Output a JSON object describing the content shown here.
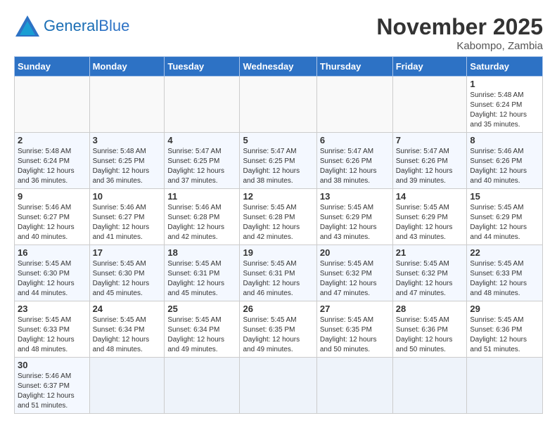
{
  "header": {
    "logo_general": "General",
    "logo_blue": "Blue",
    "month_title": "November 2025",
    "location": "Kabompo, Zambia"
  },
  "weekdays": [
    "Sunday",
    "Monday",
    "Tuesday",
    "Wednesday",
    "Thursday",
    "Friday",
    "Saturday"
  ],
  "weeks": [
    [
      {
        "day": "",
        "info": ""
      },
      {
        "day": "",
        "info": ""
      },
      {
        "day": "",
        "info": ""
      },
      {
        "day": "",
        "info": ""
      },
      {
        "day": "",
        "info": ""
      },
      {
        "day": "",
        "info": ""
      },
      {
        "day": "1",
        "info": "Sunrise: 5:48 AM\nSunset: 6:24 PM\nDaylight: 12 hours\nand 35 minutes."
      }
    ],
    [
      {
        "day": "2",
        "info": "Sunrise: 5:48 AM\nSunset: 6:24 PM\nDaylight: 12 hours\nand 36 minutes."
      },
      {
        "day": "3",
        "info": "Sunrise: 5:48 AM\nSunset: 6:25 PM\nDaylight: 12 hours\nand 36 minutes."
      },
      {
        "day": "4",
        "info": "Sunrise: 5:47 AM\nSunset: 6:25 PM\nDaylight: 12 hours\nand 37 minutes."
      },
      {
        "day": "5",
        "info": "Sunrise: 5:47 AM\nSunset: 6:25 PM\nDaylight: 12 hours\nand 38 minutes."
      },
      {
        "day": "6",
        "info": "Sunrise: 5:47 AM\nSunset: 6:26 PM\nDaylight: 12 hours\nand 38 minutes."
      },
      {
        "day": "7",
        "info": "Sunrise: 5:47 AM\nSunset: 6:26 PM\nDaylight: 12 hours\nand 39 minutes."
      },
      {
        "day": "8",
        "info": "Sunrise: 5:46 AM\nSunset: 6:26 PM\nDaylight: 12 hours\nand 40 minutes."
      }
    ],
    [
      {
        "day": "9",
        "info": "Sunrise: 5:46 AM\nSunset: 6:27 PM\nDaylight: 12 hours\nand 40 minutes."
      },
      {
        "day": "10",
        "info": "Sunrise: 5:46 AM\nSunset: 6:27 PM\nDaylight: 12 hours\nand 41 minutes."
      },
      {
        "day": "11",
        "info": "Sunrise: 5:46 AM\nSunset: 6:28 PM\nDaylight: 12 hours\nand 42 minutes."
      },
      {
        "day": "12",
        "info": "Sunrise: 5:45 AM\nSunset: 6:28 PM\nDaylight: 12 hours\nand 42 minutes."
      },
      {
        "day": "13",
        "info": "Sunrise: 5:45 AM\nSunset: 6:29 PM\nDaylight: 12 hours\nand 43 minutes."
      },
      {
        "day": "14",
        "info": "Sunrise: 5:45 AM\nSunset: 6:29 PM\nDaylight: 12 hours\nand 43 minutes."
      },
      {
        "day": "15",
        "info": "Sunrise: 5:45 AM\nSunset: 6:29 PM\nDaylight: 12 hours\nand 44 minutes."
      }
    ],
    [
      {
        "day": "16",
        "info": "Sunrise: 5:45 AM\nSunset: 6:30 PM\nDaylight: 12 hours\nand 44 minutes."
      },
      {
        "day": "17",
        "info": "Sunrise: 5:45 AM\nSunset: 6:30 PM\nDaylight: 12 hours\nand 45 minutes."
      },
      {
        "day": "18",
        "info": "Sunrise: 5:45 AM\nSunset: 6:31 PM\nDaylight: 12 hours\nand 45 minutes."
      },
      {
        "day": "19",
        "info": "Sunrise: 5:45 AM\nSunset: 6:31 PM\nDaylight: 12 hours\nand 46 minutes."
      },
      {
        "day": "20",
        "info": "Sunrise: 5:45 AM\nSunset: 6:32 PM\nDaylight: 12 hours\nand 47 minutes."
      },
      {
        "day": "21",
        "info": "Sunrise: 5:45 AM\nSunset: 6:32 PM\nDaylight: 12 hours\nand 47 minutes."
      },
      {
        "day": "22",
        "info": "Sunrise: 5:45 AM\nSunset: 6:33 PM\nDaylight: 12 hours\nand 48 minutes."
      }
    ],
    [
      {
        "day": "23",
        "info": "Sunrise: 5:45 AM\nSunset: 6:33 PM\nDaylight: 12 hours\nand 48 minutes."
      },
      {
        "day": "24",
        "info": "Sunrise: 5:45 AM\nSunset: 6:34 PM\nDaylight: 12 hours\nand 48 minutes."
      },
      {
        "day": "25",
        "info": "Sunrise: 5:45 AM\nSunset: 6:34 PM\nDaylight: 12 hours\nand 49 minutes."
      },
      {
        "day": "26",
        "info": "Sunrise: 5:45 AM\nSunset: 6:35 PM\nDaylight: 12 hours\nand 49 minutes."
      },
      {
        "day": "27",
        "info": "Sunrise: 5:45 AM\nSunset: 6:35 PM\nDaylight: 12 hours\nand 50 minutes."
      },
      {
        "day": "28",
        "info": "Sunrise: 5:45 AM\nSunset: 6:36 PM\nDaylight: 12 hours\nand 50 minutes."
      },
      {
        "day": "29",
        "info": "Sunrise: 5:45 AM\nSunset: 6:36 PM\nDaylight: 12 hours\nand 51 minutes."
      }
    ],
    [
      {
        "day": "30",
        "info": "Sunrise: 5:46 AM\nSunset: 6:37 PM\nDaylight: 12 hours\nand 51 minutes."
      },
      {
        "day": "",
        "info": ""
      },
      {
        "day": "",
        "info": ""
      },
      {
        "day": "",
        "info": ""
      },
      {
        "day": "",
        "info": ""
      },
      {
        "day": "",
        "info": ""
      },
      {
        "day": "",
        "info": ""
      }
    ]
  ]
}
